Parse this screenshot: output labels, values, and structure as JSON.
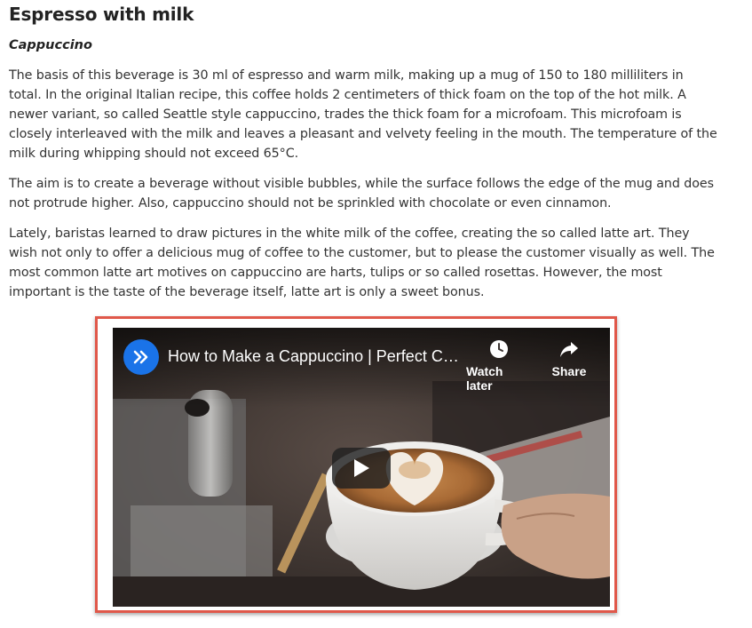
{
  "article": {
    "title": "Espresso with milk",
    "subtitle": "Cappuccino",
    "paragraphs": [
      "The basis of this beverage is 30 ml of espresso and warm milk, making up a mug of 150 to 180 milliliters in total. In the original Italian recipe, this coffee holds 2 centimeters of thick foam on the top of the hot milk. A newer variant, so called Seattle style cappuccino, trades the thick foam for a microfoam. This microfoam is closely interleaved with the milk and leaves a pleasant and velvety feeling in the mouth. The temperature of the milk during whipping should not exceed 65°C.",
      "The aim is to create a beverage without visible bubbles, while the surface follows the edge of the mug and does not protrude higher. Also, cappuccino should not be sprinkled with chocolate or even cinnamon.",
      "Lately, baristas learned to draw pictures in the white milk of the coffee, creating the so called latte art. They wish not only to offer a delicious mug of coffee to the customer, but to please the customer visually as well. The most common latte art motives on cappuccino are harts, tulips or so called rosettas. However, the most important is the taste of the beverage itself, latte art is only a sweet bonus."
    ]
  },
  "video": {
    "title": "How to Make a Cappuccino | Perfect Coffee",
    "watch_later_label": "Watch later",
    "share_label": "Share",
    "icons": {
      "channel": "double-chevron-right-icon",
      "watch_later": "clock-icon",
      "share": "share-arrow-icon",
      "play": "play-icon"
    }
  },
  "colors": {
    "highlight_border": "#e0584a",
    "channel_avatar": "#1a73e8"
  }
}
